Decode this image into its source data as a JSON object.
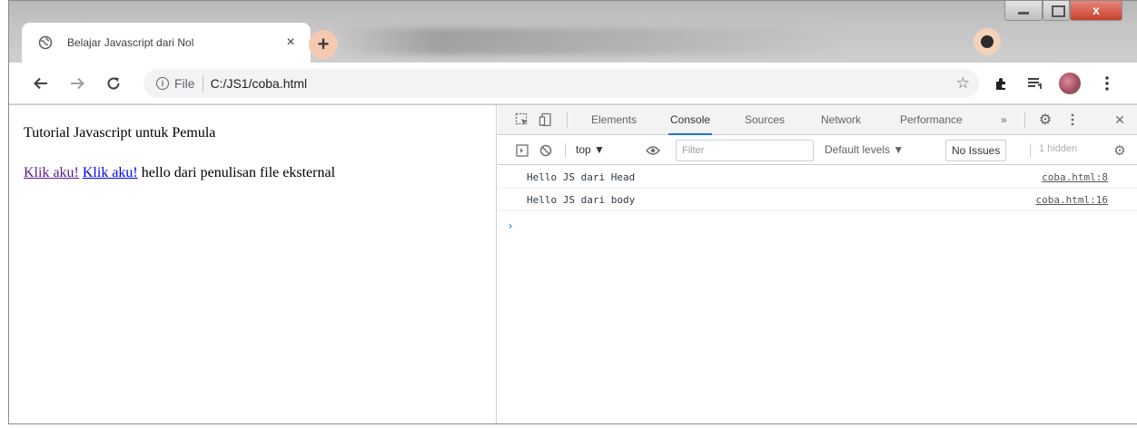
{
  "browser": {
    "tab_title": "Belajar Javascript dari Nol",
    "tab_close": "×",
    "new_tab": "+",
    "url_scheme": "File",
    "url_path": "C:/JS1/coba.html",
    "window_close": "x"
  },
  "page": {
    "heading": "Tutorial Javascript untuk Pemula",
    "link1": "Klik aku!",
    "link2": "Klik aku!",
    "body_text": "hello dari penulisan file eksternal"
  },
  "devtools": {
    "tabs": [
      "Elements",
      "Console",
      "Sources",
      "Network",
      "Performance"
    ],
    "active_tab": "Console",
    "more_tabs": "»",
    "context": "top ▼",
    "filter_placeholder": "Filter",
    "levels": "Default levels ▼",
    "issues": "No Issues",
    "hidden": "1 hidden",
    "logs": [
      {
        "message": "Hello JS dari Head",
        "source": "coba.html:8"
      },
      {
        "message": "Hello JS dari body",
        "source": "coba.html:16"
      }
    ],
    "prompt": "›"
  },
  "colors": {
    "active_tab_underline": "#1a73e8",
    "new_tab_button": "#f5c9b0",
    "visited_link": "#551a8b",
    "link": "#0000ee"
  }
}
